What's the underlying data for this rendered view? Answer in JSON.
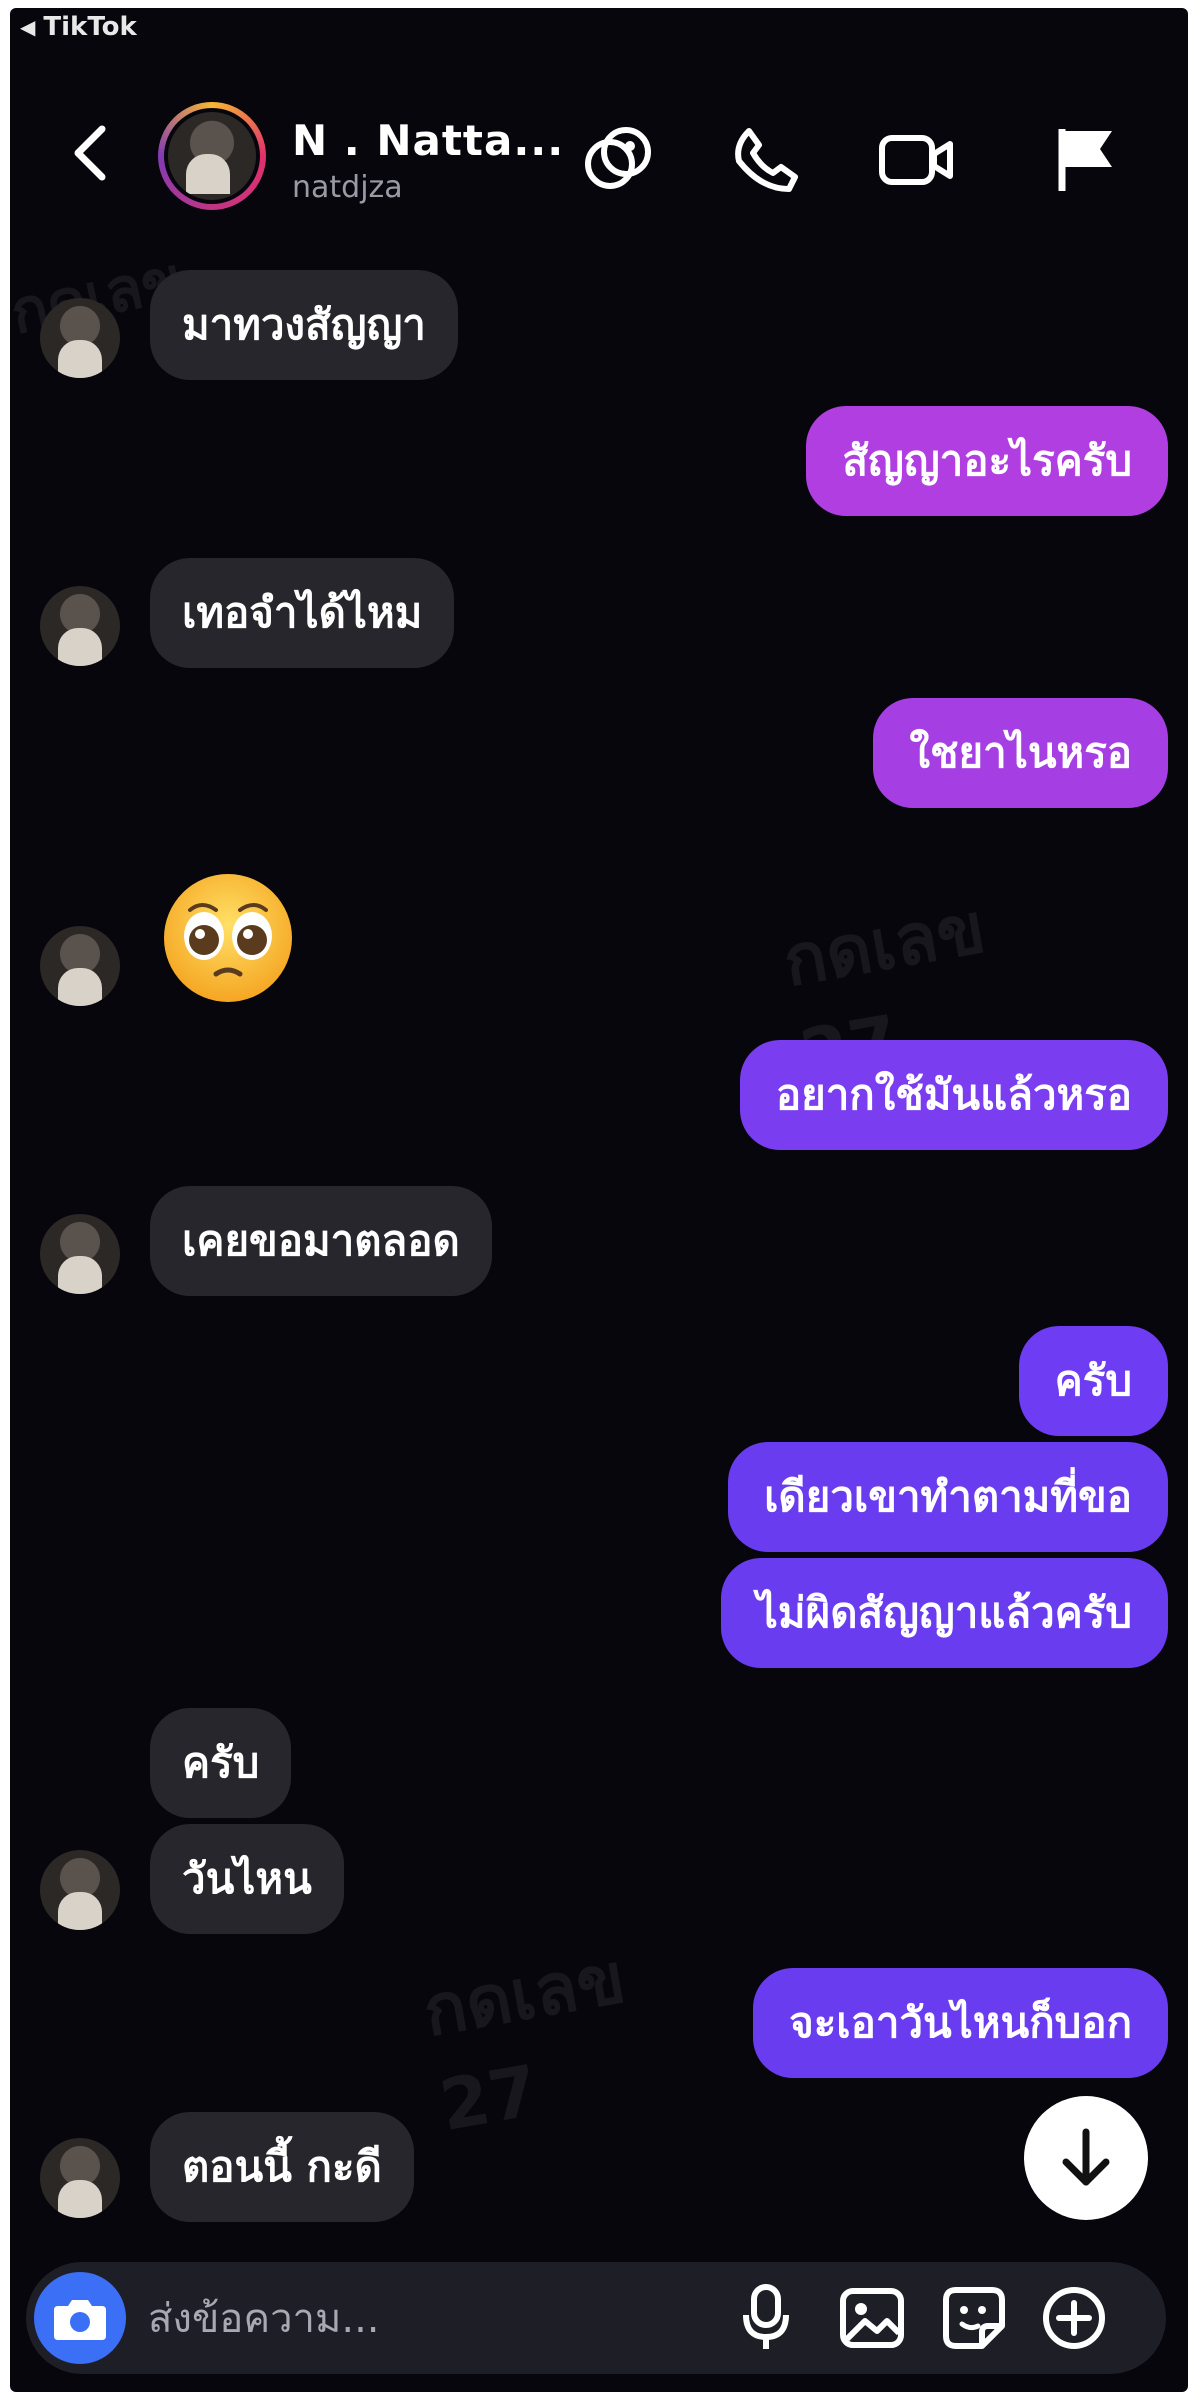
{
  "status_bar": {
    "back_app_label": "TikTok"
  },
  "header": {
    "name": "N . Natta...",
    "username": "natdjza"
  },
  "colors": {
    "outgoing_gradient_top": "#b23fe0",
    "outgoing_gradient_bottom": "#6a3cf0",
    "incoming_bubble": "#26262c",
    "background": "#06060c",
    "camera_button": "#3b6ff5"
  },
  "messages": [
    {
      "side": "in",
      "text": "มาทวงสัญญา"
    },
    {
      "side": "out",
      "text": "สัญญาอะไรครับ"
    },
    {
      "side": "in",
      "text": "เทอจำได้ไหม"
    },
    {
      "side": "out",
      "text": "ใชยาไนหรอ"
    },
    {
      "side": "in",
      "emoji": "pleading-face"
    },
    {
      "side": "out",
      "text": "อยากใช้มันแล้วหรอ"
    },
    {
      "side": "in",
      "text": "เคยขอมาตลอด"
    },
    {
      "side": "out",
      "text": "ครับ"
    },
    {
      "side": "out",
      "text": "เดียวเขาทำตามที่ขอ"
    },
    {
      "side": "out",
      "text": "ไม่ผิดสัญญาแล้วครับ"
    },
    {
      "side": "in",
      "text": "ครับ"
    },
    {
      "side": "in",
      "text": "วันไหน"
    },
    {
      "side": "out",
      "text": "จะเอาวันไหนก็บอก"
    },
    {
      "side": "in",
      "text": "ตอนนี้ กะดี"
    }
  ],
  "composer": {
    "placeholder": "ส่งข้อความ..."
  },
  "watermark": {
    "text": "กดเลข",
    "number": "27"
  }
}
